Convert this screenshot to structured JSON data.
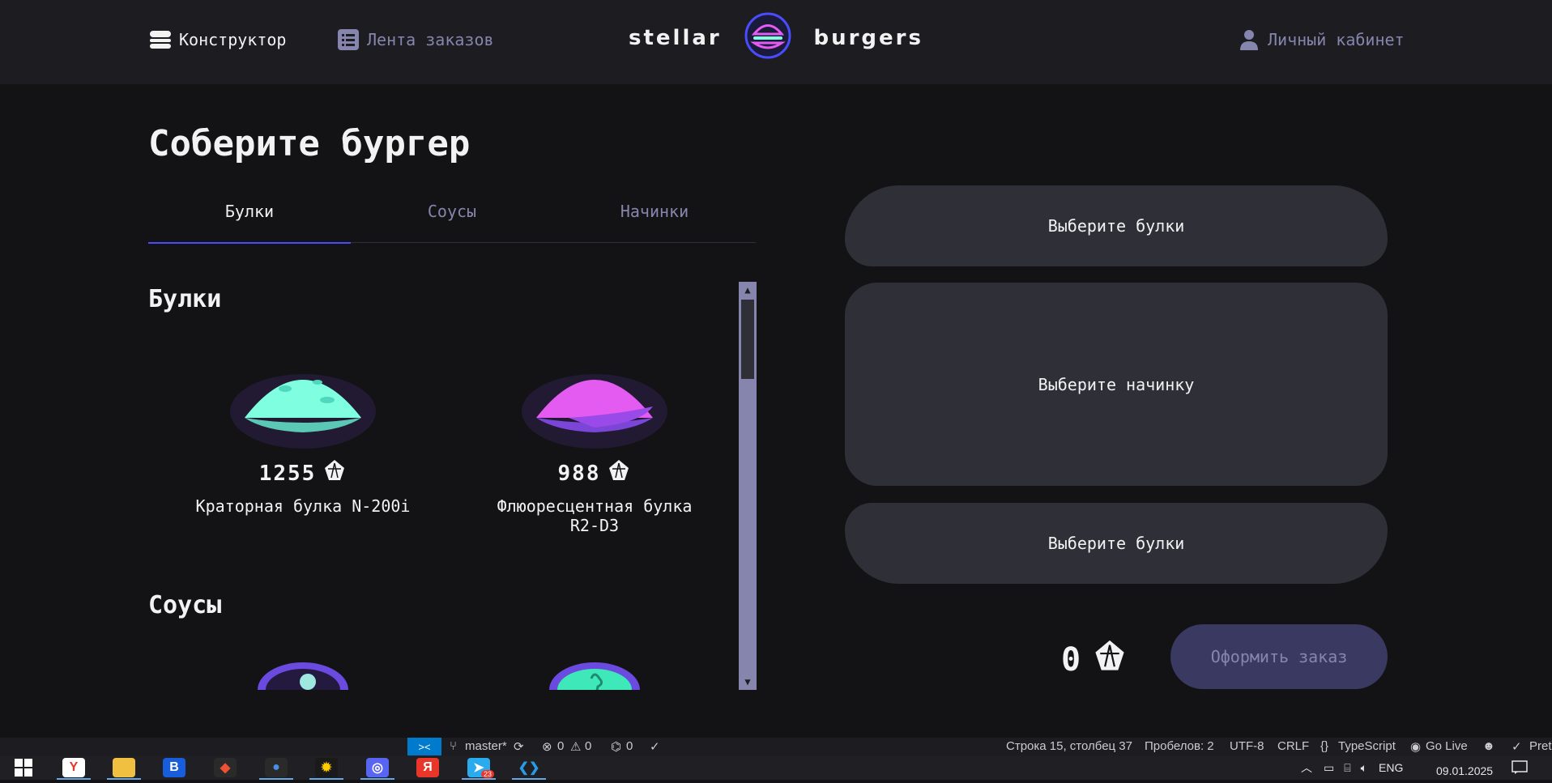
{
  "header": {
    "constructor_label": "Конструктор",
    "feed_label": "Лента заказов",
    "logo_left": "stellar",
    "logo_right": "burgers",
    "account_label": "Личный кабинет"
  },
  "main": {
    "title": "Соберите бургер",
    "tabs": [
      {
        "label": "Булки",
        "active": true
      },
      {
        "label": "Соусы",
        "active": false
      },
      {
        "label": "Начинки",
        "active": false
      }
    ],
    "sections": [
      {
        "title": "Булки",
        "items": [
          {
            "price": "1255",
            "name": "Краторная булка N-200i",
            "color": "#7fffe0"
          },
          {
            "price": "988",
            "name": "Флюоресцентная булка R2-D3",
            "color": "#e35bf0"
          }
        ]
      },
      {
        "title": "Соусы",
        "items": [
          {
            "color": "#3a2a7a"
          },
          {
            "color": "#3ee8b8"
          }
        ]
      }
    ]
  },
  "constructor": {
    "top_placeholder": "Выберите булки",
    "middle_placeholder": "Выберите начинку",
    "bottom_placeholder": "Выберите булки",
    "total": "0",
    "order_button": "Оформить заказ"
  },
  "statusbar": {
    "remote_icon": "><",
    "branch": "master*",
    "errors": "0",
    "warnings": "0",
    "ports": "0",
    "position": "Строка 15, столбец 37",
    "spaces": "Пробелов: 2",
    "encoding": "UTF-8",
    "eol": "CRLF",
    "language": "TypeScript",
    "golive": "Go Live",
    "prettier": "Pret"
  },
  "taskbar": {
    "apps": [
      {
        "name": "yandex-browser-icon",
        "letter": "Y",
        "color": "#ffffff",
        "fg": "#e8372a"
      },
      {
        "name": "file-explorer-icon",
        "letter": "",
        "color": "#f0c040",
        "fg": "#fff"
      },
      {
        "name": "bitwarden-icon",
        "letter": "B",
        "color": "#175ddc",
        "fg": "#fff"
      },
      {
        "name": "git-icon",
        "letter": "◆",
        "color": "#2a2a2a",
        "fg": "#f05033"
      },
      {
        "name": "chrome-icon",
        "letter": "●",
        "color": "#2a2a2a",
        "fg": "#4a90e2"
      },
      {
        "name": "stardock-icon",
        "letter": "✹",
        "color": "#1a1a1a",
        "fg": "#ffcc00"
      },
      {
        "name": "discord-icon",
        "letter": "◎",
        "color": "#5865f2",
        "fg": "#fff"
      },
      {
        "name": "yandex-music-icon",
        "letter": "Я",
        "color": "#e8372a",
        "fg": "#fff"
      },
      {
        "name": "telegram-icon",
        "letter": "➤",
        "color": "#2aabee",
        "fg": "#fff"
      },
      {
        "name": "vscode-icon",
        "letter": "❮❯",
        "color": "#1f1f24",
        "fg": "#2a9ae6"
      }
    ],
    "telegram_badge": "23",
    "lang": "ENG",
    "date": "09.01.2025"
  },
  "colors": {
    "accent": "#4c4cff",
    "muted": "#8585ad",
    "card": "#2f2f37",
    "header": "#1c1c21",
    "background": "#131316"
  }
}
